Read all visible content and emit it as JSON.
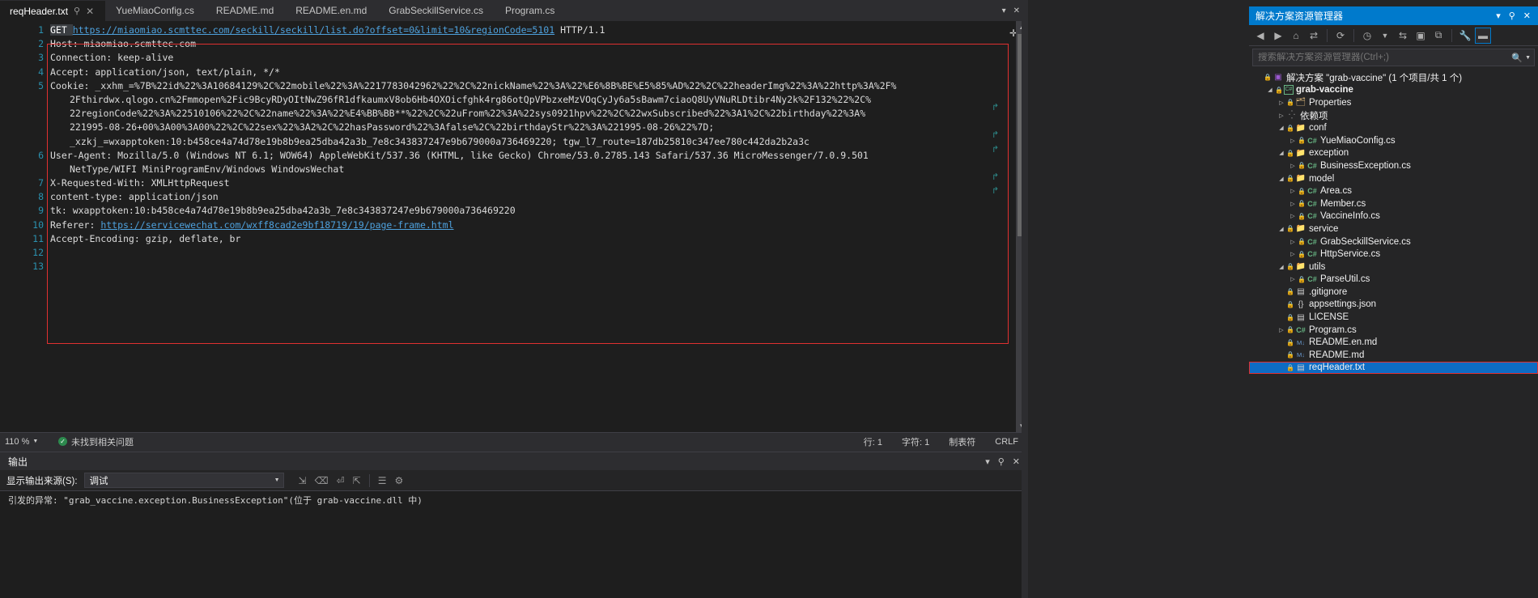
{
  "window": {
    "editor_tabs": [
      {
        "label": "reqHeader.txt",
        "active": true,
        "pinned": true,
        "closable": true
      },
      {
        "label": "YueMiaoConfig.cs",
        "active": false
      },
      {
        "label": "README.md",
        "active": false
      },
      {
        "label": "README.en.md",
        "active": false
      },
      {
        "label": "GrabSeckillService.cs",
        "active": false
      },
      {
        "label": "Program.cs",
        "active": false
      }
    ],
    "tab_actions": {
      "dropdown": "▾",
      "close": "✕"
    }
  },
  "editor": {
    "file": "reqHeader.txt",
    "lines": [
      {
        "n": "1",
        "segments": [
          {
            "t": "GET ",
            "style": "kwhl"
          },
          {
            "t": "https://miaomiao.scmttec.com/seckill/seckill/list.do?offset=0&limit=10&regionCode=5101",
            "style": "link"
          },
          {
            "t": " HTTP/1.1",
            "style": "plain"
          }
        ]
      },
      {
        "n": "2",
        "segments": [
          {
            "t": "Host: miaomiao.scmttec.com",
            "style": "plain"
          }
        ]
      },
      {
        "n": "3",
        "segments": [
          {
            "t": "Connection: keep-alive",
            "style": "plain"
          }
        ]
      },
      {
        "n": "4",
        "segments": [
          {
            "t": "Accept: application/json, text/plain, */*",
            "style": "plain"
          }
        ]
      },
      {
        "n": "5",
        "segments": [
          {
            "t": "Cookie: _xxhm_=%7B%22id%22%3A10684129%2C%22mobile%22%3A%2217783042962%22%2C%22nickName%22%3A%22%E6%8B%BE%E5%85%AD%22%2C%22headerImg%22%3A%22http%3A%2F%",
            "style": "plain"
          }
        ]
      },
      {
        "n": "",
        "wrap": true,
        "segments": [
          {
            "t": "2Fthirdwx.qlogo.cn%2Fmmopen%2Fic9BcyRDyOItNwZ96fR1dfkaumxV8ob6Hb4OXOicfghk4rg86otQpVPbzxeMzVOqCyJy6a5sBawm7ciaoQ8UyVNuRLDtibr4Ny2k%2F132%22%2C%",
            "style": "plain"
          }
        ]
      },
      {
        "n": "",
        "wrap": true,
        "segments": [
          {
            "t": "22regionCode%22%3A%22510106%22%2C%22name%22%3A%22%E4%BB%BB**%22%2C%22uFrom%22%3A%22sys0921hpv%22%2C%22wxSubscribed%22%3A1%2C%22birthday%22%3A%",
            "style": "plain"
          }
        ]
      },
      {
        "n": "",
        "wrap": true,
        "segments": [
          {
            "t": "221995-08-26+00%3A00%3A00%22%2C%22sex%22%3A2%2C%22hasPassword%22%3Afalse%2C%22birthdayStr%22%3A%221995-08-26%22%7D;",
            "style": "plain"
          }
        ]
      },
      {
        "n": "",
        "wrap": true,
        "segments": [
          {
            "t": "_xzkj_=wxapptoken:10:b458ce4a74d78e19b8b9ea25dba42a3b_7e8c343837247e9b679000a736469220; tgw_l7_route=187db25810c347ee780c442da2b2a3c",
            "style": "plain"
          }
        ]
      },
      {
        "n": "6",
        "segments": [
          {
            "t": "User-Agent: Mozilla/5.0 (Windows NT 6.1; WOW64) AppleWebKit/537.36 (KHTML, like Gecko) Chrome/53.0.2785.143 Safari/537.36 MicroMessenger/7.0.9.501",
            "style": "plain"
          }
        ]
      },
      {
        "n": "",
        "wrap": true,
        "segments": [
          {
            "t": "NetType/WIFI MiniProgramEnv/Windows WindowsWechat",
            "style": "plain"
          }
        ]
      },
      {
        "n": "7",
        "segments": [
          {
            "t": "X-Requested-With: XMLHttpRequest",
            "style": "plain"
          }
        ]
      },
      {
        "n": "8",
        "segments": [
          {
            "t": "content-type: application/json",
            "style": "plain"
          }
        ]
      },
      {
        "n": "9",
        "segments": [
          {
            "t": "tk: wxapptoken:10:b458ce4a74d78e19b8b9ea25dba42a3b_7e8c343837247e9b679000a736469220",
            "style": "plain"
          }
        ]
      },
      {
        "n": "10",
        "segments": [
          {
            "t": "Referer: ",
            "style": "plain"
          },
          {
            "t": "https://servicewechat.com/wxff8cad2e9bf18719/19/page-frame.html",
            "style": "link"
          }
        ]
      },
      {
        "n": "11",
        "segments": [
          {
            "t": "Accept-Encoding: gzip, deflate, br",
            "style": "plain"
          }
        ]
      },
      {
        "n": "12",
        "segments": [
          {
            "t": "",
            "style": "plain"
          }
        ]
      },
      {
        "n": "13",
        "segments": [
          {
            "t": "",
            "style": "plain"
          }
        ]
      }
    ],
    "highlight_box_color": "#e03030"
  },
  "editor_status": {
    "zoom": "110 %",
    "issues": "未找到相关问题",
    "line": "行: 1",
    "col": "字符: 1",
    "tabs_mode": "制表符",
    "eol": "CRLF"
  },
  "output": {
    "title": "输出",
    "source_label": "显示输出来源(S):",
    "source_value": "调试",
    "body": "引发的异常: \"grab_vaccine.exception.BusinessException\"(位于 grab-vaccine.dll 中)"
  },
  "solution_explorer": {
    "title": "解决方案资源管理器",
    "header_actions": {
      "dropdown": "▾",
      "pin": "⚲",
      "close": "✕"
    },
    "toolbar_icons": [
      "back-icon",
      "forward-icon",
      "home-icon",
      "sync-with-active-doc-icon",
      "refresh-icon",
      "pending-changes-icon",
      "show-all-files-icon",
      "collapse-all-icon",
      "properties-icon",
      "preview-selected-items-icon"
    ],
    "search_placeholder": "搜索解决方案资源管理器(Ctrl+;)",
    "tree": [
      {
        "depth": 0,
        "chev": "",
        "icon": "sln",
        "label": "解决方案 \"grab-vaccine\" (1 个项目/共 1 个)",
        "bold": false,
        "lock": true
      },
      {
        "depth": 1,
        "chev": "open",
        "icon": "proj",
        "label": "grab-vaccine",
        "bold": true,
        "lock": true
      },
      {
        "depth": 2,
        "chev": "closed",
        "icon": "folder-props",
        "label": "Properties",
        "bold": false,
        "lock": true
      },
      {
        "depth": 2,
        "chev": "closed",
        "icon": "deps",
        "label": "依赖项",
        "bold": false,
        "lock": false
      },
      {
        "depth": 2,
        "chev": "open",
        "icon": "folder",
        "label": "conf",
        "bold": false,
        "lock": true
      },
      {
        "depth": 3,
        "chev": "closed",
        "icon": "cs",
        "label": "YueMiaoConfig.cs",
        "bold": false,
        "lock": true
      },
      {
        "depth": 2,
        "chev": "open",
        "icon": "folder",
        "label": "exception",
        "bold": false,
        "lock": true
      },
      {
        "depth": 3,
        "chev": "closed",
        "icon": "cs",
        "label": "BusinessException.cs",
        "bold": false,
        "lock": true
      },
      {
        "depth": 2,
        "chev": "open",
        "icon": "folder",
        "label": "model",
        "bold": false,
        "lock": true
      },
      {
        "depth": 3,
        "chev": "closed",
        "icon": "cs",
        "label": "Area.cs",
        "bold": false,
        "lock": true
      },
      {
        "depth": 3,
        "chev": "closed",
        "icon": "cs",
        "label": "Member.cs",
        "bold": false,
        "lock": true
      },
      {
        "depth": 3,
        "chev": "closed",
        "icon": "cs",
        "label": "VaccineInfo.cs",
        "bold": false,
        "lock": true
      },
      {
        "depth": 2,
        "chev": "open",
        "icon": "folder",
        "label": "service",
        "bold": false,
        "lock": true
      },
      {
        "depth": 3,
        "chev": "closed",
        "icon": "cs",
        "label": "GrabSeckillService.cs",
        "bold": false,
        "lock": true
      },
      {
        "depth": 3,
        "chev": "closed",
        "icon": "cs",
        "label": "HttpService.cs",
        "bold": false,
        "lock": true
      },
      {
        "depth": 2,
        "chev": "open",
        "icon": "folder",
        "label": "utils",
        "bold": false,
        "lock": true
      },
      {
        "depth": 3,
        "chev": "closed",
        "icon": "cs",
        "label": "ParseUtil.cs",
        "bold": false,
        "lock": true
      },
      {
        "depth": 2,
        "chev": "",
        "icon": "txt",
        "label": ".gitignore",
        "bold": false,
        "lock": true
      },
      {
        "depth": 2,
        "chev": "",
        "icon": "json",
        "label": "appsettings.json",
        "bold": false,
        "lock": true
      },
      {
        "depth": 2,
        "chev": "",
        "icon": "lic",
        "label": "LICENSE",
        "bold": false,
        "lock": true
      },
      {
        "depth": 2,
        "chev": "closed",
        "icon": "cs",
        "label": "Program.cs",
        "bold": false,
        "lock": true
      },
      {
        "depth": 2,
        "chev": "",
        "icon": "md",
        "label": "README.en.md",
        "bold": false,
        "lock": true
      },
      {
        "depth": 2,
        "chev": "",
        "icon": "md",
        "label": "README.md",
        "bold": false,
        "lock": true
      },
      {
        "depth": 2,
        "chev": "",
        "icon": "txt",
        "label": "reqHeader.txt",
        "bold": false,
        "lock": true,
        "selected": true,
        "highlight": true
      }
    ],
    "selected_highlight_color": "#e03030",
    "selection_color": "#0d6cc4"
  }
}
